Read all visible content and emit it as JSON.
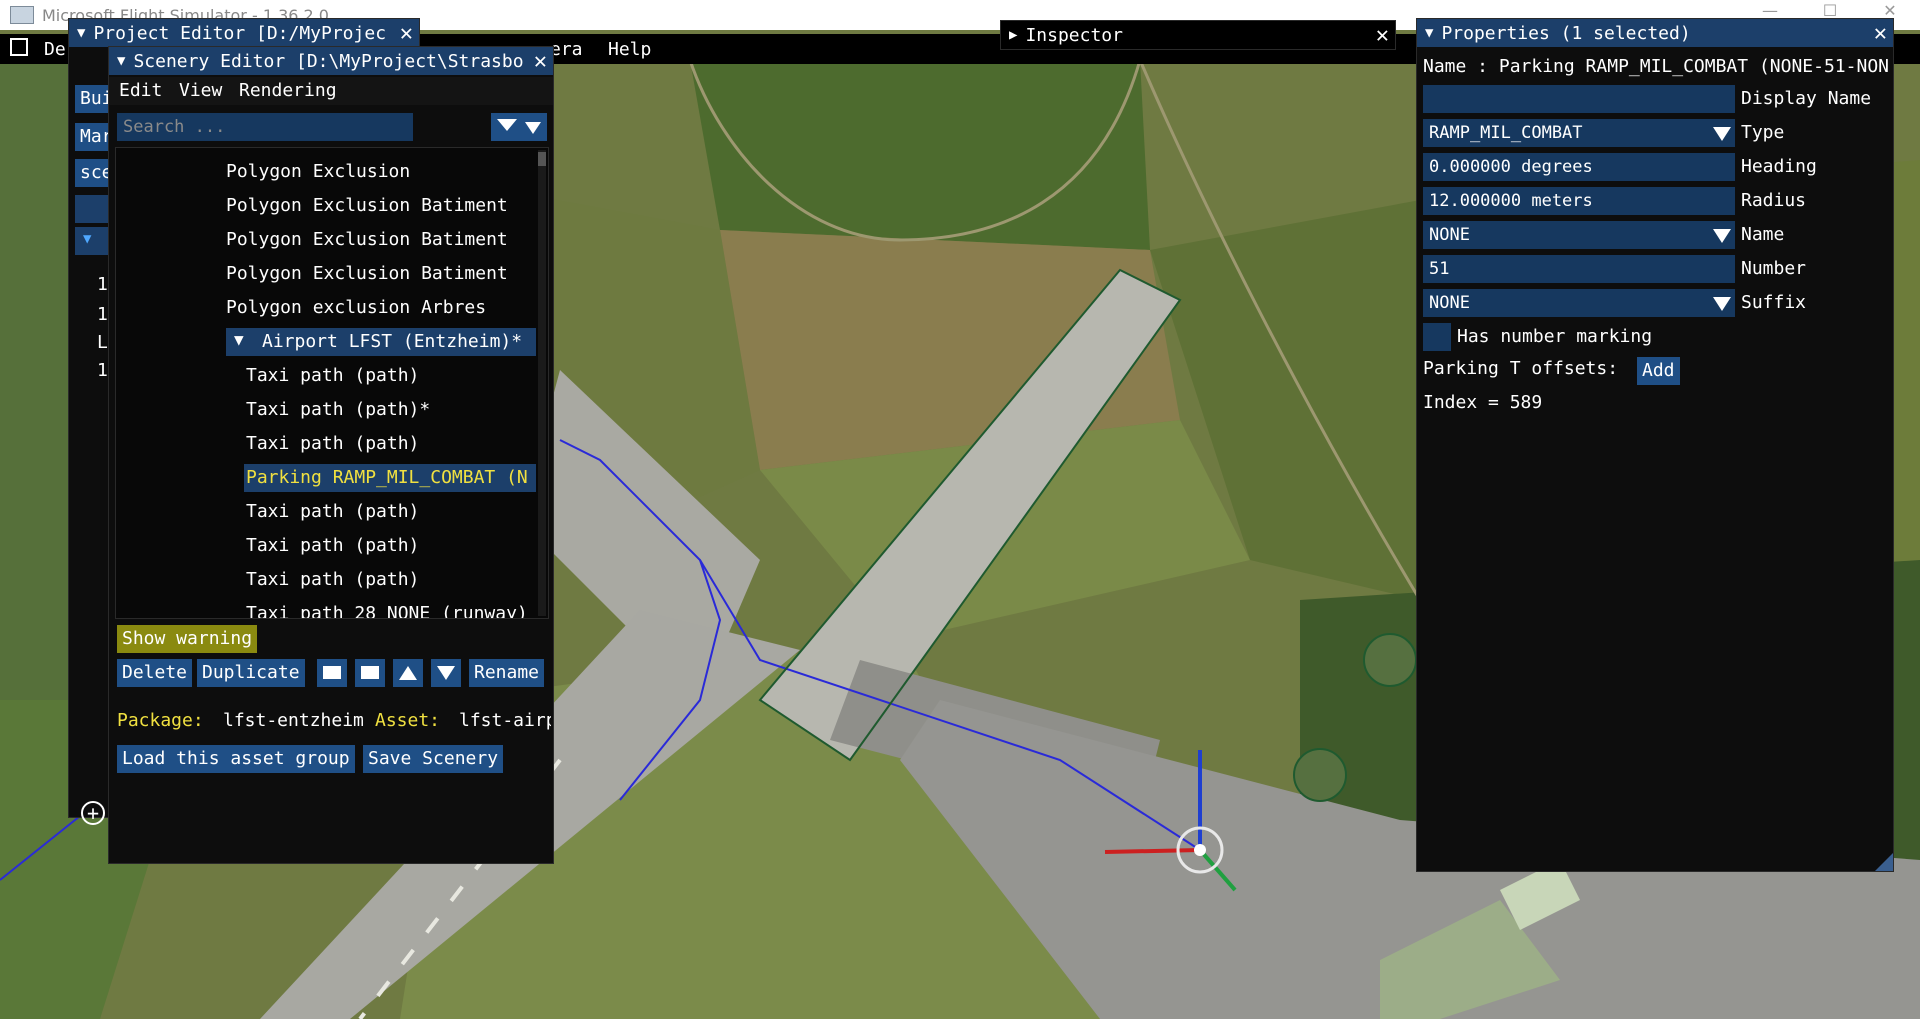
{
  "window": {
    "title": "Microsoft Flight Simulator - 1.36.2.0"
  },
  "main_menu": {
    "items": [
      "De",
      "era",
      "Help"
    ]
  },
  "project_editor": {
    "title": "Project Editor [D:/MyProjec",
    "side_buttons": [
      "Bui",
      "Mar",
      "sce"
    ],
    "side_labels": [
      "1",
      "1",
      "L",
      "1"
    ]
  },
  "scenery_editor": {
    "title": "Scenery Editor [D:\\MyProject\\Strasbo",
    "menu": [
      "Edit",
      "View",
      "Rendering"
    ],
    "search_placeholder": "Search ...",
    "tree": [
      {
        "label": "Polygon Exclusion",
        "indent": 0
      },
      {
        "label": "Polygon Exclusion Batiment",
        "indent": 0
      },
      {
        "label": "Polygon Exclusion Batiment",
        "indent": 0
      },
      {
        "label": "Polygon Exclusion Batiment",
        "indent": 0
      },
      {
        "label": "Polygon exclusion Arbres",
        "indent": 0
      },
      {
        "label": "Airport LFST (Entzheim)*",
        "indent": 0,
        "group": true
      },
      {
        "label": "Taxi path  (path)",
        "indent": 1
      },
      {
        "label": "Taxi path  (path)*",
        "indent": 1
      },
      {
        "label": "Taxi path  (path)",
        "indent": 1
      },
      {
        "label": "Parking RAMP_MIL_COMBAT (N",
        "indent": 1,
        "selected": true
      },
      {
        "label": "Taxi path  (path)",
        "indent": 1
      },
      {
        "label": "Taxi path  (path)",
        "indent": 1
      },
      {
        "label": "Taxi path  (path)",
        "indent": 1
      },
      {
        "label": "Taxi path 28 NONE (runway)",
        "indent": 1
      }
    ],
    "show_warning": "Show warning",
    "buttons": {
      "delete": "Delete",
      "duplicate": "Duplicate",
      "rename": "Rename"
    },
    "package_label": "Package:",
    "package_value": "lfst-entzheim",
    "asset_label": "Asset:",
    "asset_value": "lfst-airp",
    "load_group": "Load this asset group",
    "save_scenery": "Save Scenery"
  },
  "inspector": {
    "title": "Inspector"
  },
  "properties": {
    "title": "Properties (1 selected)",
    "name_line": "Name : Parking RAMP_MIL_COMBAT (NONE-51-NON",
    "display_name_value": "",
    "display_name_label": "Display Name",
    "type_value": "RAMP_MIL_COMBAT",
    "type_label": "Type",
    "heading_value": "0.000000 degrees",
    "heading_label": "Heading",
    "radius_value": "12.000000 meters",
    "radius_label": "Radius",
    "name_value": "NONE",
    "name_label": "Name",
    "number_value": "51",
    "number_label": "Number",
    "suffix_value": "NONE",
    "suffix_label": "Suffix",
    "has_number_marking": "Has number marking",
    "parking_offsets_label": "Parking T offsets:",
    "add_button": "Add",
    "index_line": "Index = 589"
  },
  "colors": {
    "title_bar": "#1c3f6a",
    "field_bg": "#16385f",
    "button_bg": "#1f4f86",
    "selected_text": "#f0e040",
    "warning_bg": "#8a8a10",
    "panel_bg": "#0d0d0d"
  }
}
